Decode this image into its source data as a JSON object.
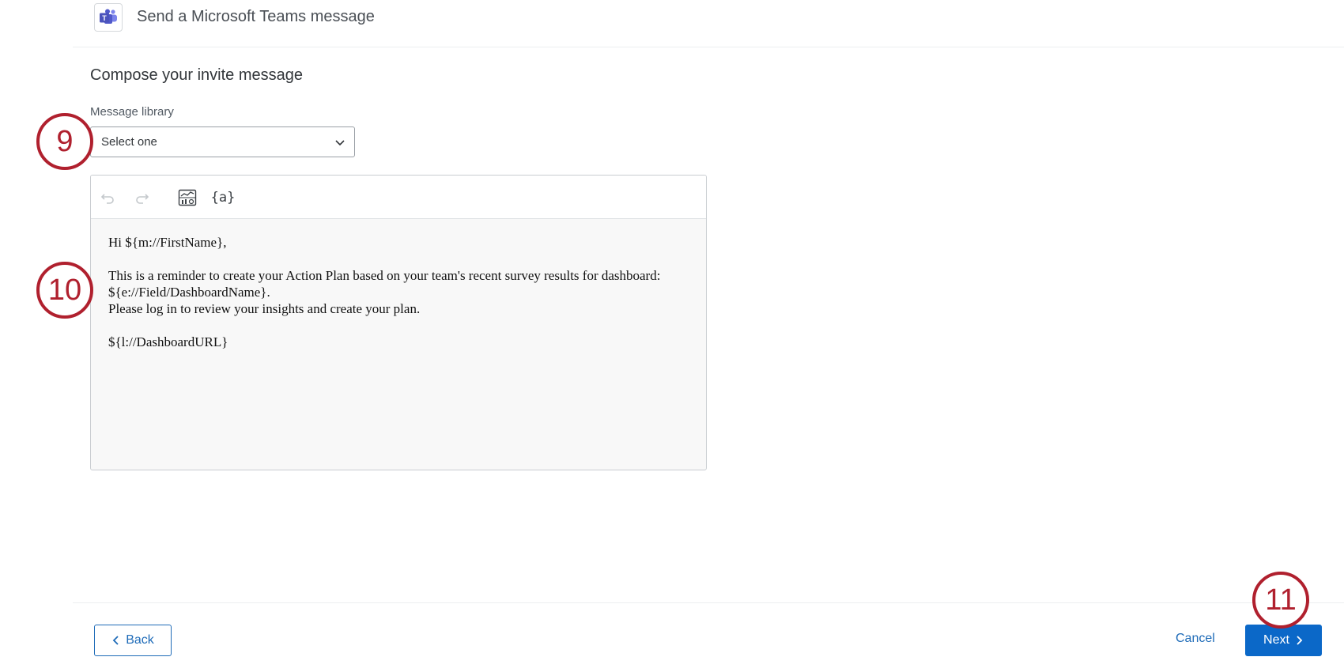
{
  "header": {
    "title": "Send a Microsoft Teams message",
    "logo_icon": "microsoft-teams-icon"
  },
  "compose": {
    "section_title": "Compose your invite message",
    "message_library": {
      "label": "Message library",
      "selected": "Select one"
    }
  },
  "editor": {
    "toolbar": {
      "undo_icon": "undo-icon",
      "redo_icon": "redo-icon",
      "dashboard_icon": "dashboard-data-icon",
      "piped_text_label": "{a}"
    },
    "lines": [
      "Hi ${m://FirstName},",
      "",
      "This is a reminder to create your Action Plan based on your team's recent survey results for dashboard:",
      "${e://Field/DashboardName}.",
      "Please log in to review your insights and create your plan.",
      "",
      "${l://DashboardURL}"
    ]
  },
  "footer": {
    "back_label": "Back",
    "cancel_label": "Cancel",
    "next_label": "Next"
  },
  "annotations": {
    "step_9": "9",
    "step_10": "10",
    "step_11": "11"
  },
  "colors": {
    "accent": "#0b68c8",
    "link": "#1e6bb8",
    "annotation": "#b0202e",
    "teams_purple": "#5059c9"
  }
}
